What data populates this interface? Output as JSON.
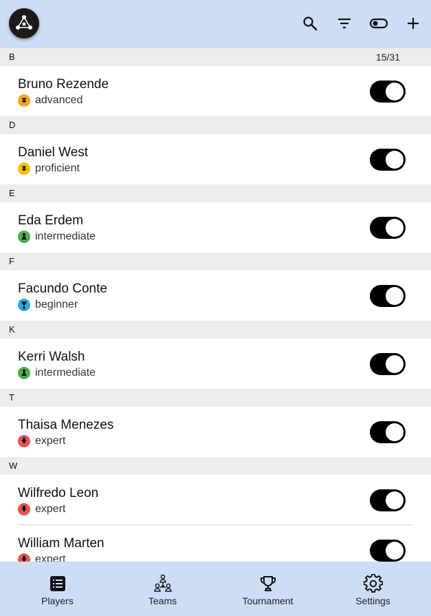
{
  "list": {
    "counter": "15/31",
    "sections": [
      {
        "letter": "B",
        "players": [
          {
            "name": "Bruno Rezende",
            "level": "advanced",
            "color": "#f5a623"
          }
        ]
      },
      {
        "letter": "D",
        "players": [
          {
            "name": "Daniel West",
            "level": "proficient",
            "color": "#f4c20d"
          }
        ]
      },
      {
        "letter": "E",
        "players": [
          {
            "name": "Eda Erdem",
            "level": "intermediate",
            "color": "#4caf50"
          }
        ]
      },
      {
        "letter": "F",
        "players": [
          {
            "name": "Facundo Conte",
            "level": "beginner",
            "color": "#29a8e0"
          }
        ]
      },
      {
        "letter": "K",
        "players": [
          {
            "name": "Kerri Walsh",
            "level": "intermediate",
            "color": "#4caf50"
          }
        ]
      },
      {
        "letter": "T",
        "players": [
          {
            "name": "Thaisa Menezes",
            "level": "expert",
            "color": "#e85454"
          }
        ]
      },
      {
        "letter": "W",
        "players": [
          {
            "name": "Wilfredo Leon",
            "level": "expert",
            "color": "#e85454"
          },
          {
            "name": "William Marten",
            "level": "expert",
            "color": "#e85454"
          }
        ]
      }
    ]
  },
  "nav": {
    "players": "Players",
    "teams": "Teams",
    "tournament": "Tournament",
    "settings": "Settings"
  }
}
